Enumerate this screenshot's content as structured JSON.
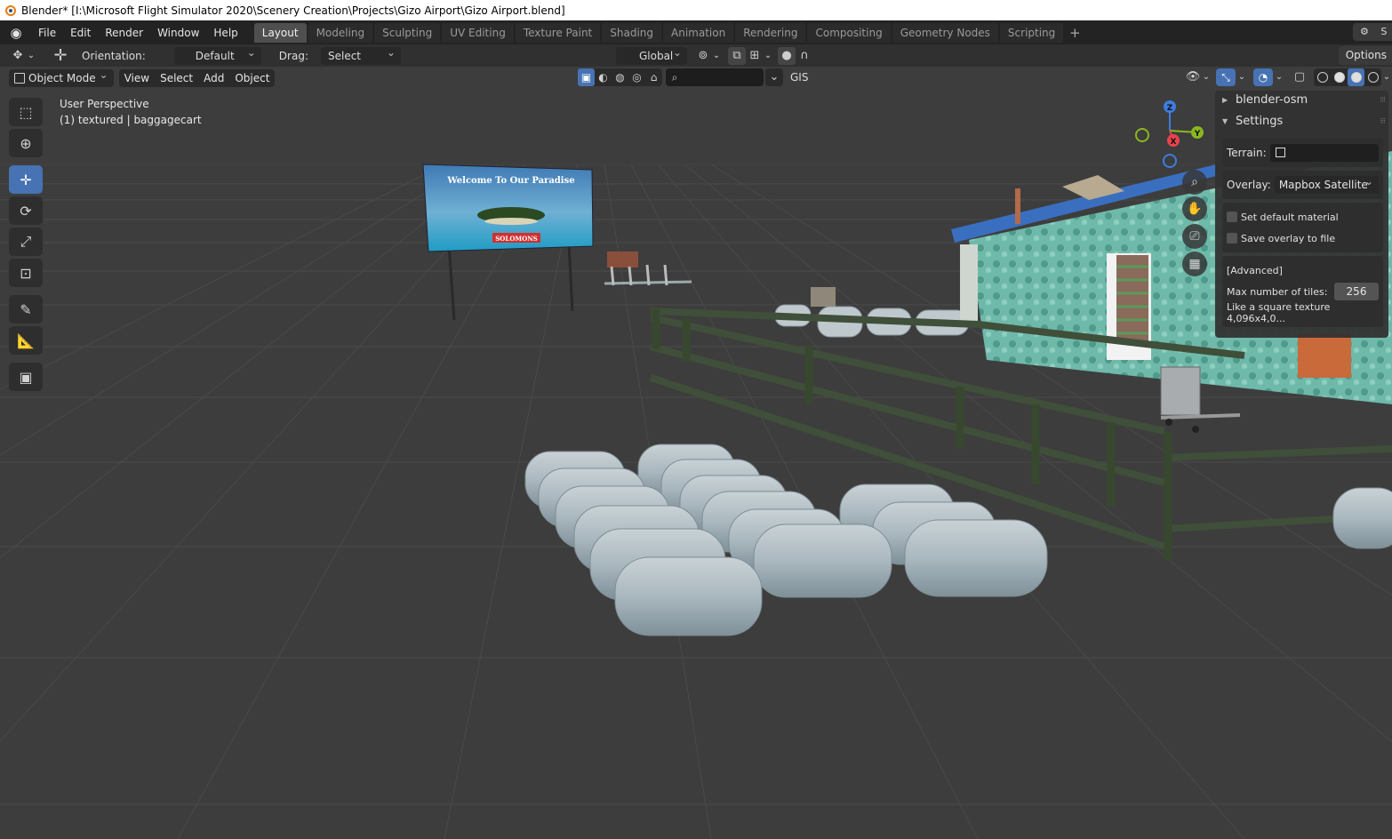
{
  "window": {
    "title": "Blender* [I:\\Microsoft Flight Simulator 2020\\Scenery Creation\\Projects\\Gizo Airport\\Gizo Airport.blend]"
  },
  "menu": {
    "items": [
      "File",
      "Edit",
      "Render",
      "Window",
      "Help"
    ]
  },
  "workspaces": {
    "tabs": [
      "Layout",
      "Modeling",
      "Sculpting",
      "UV Editing",
      "Texture Paint",
      "Shading",
      "Animation",
      "Rendering",
      "Compositing",
      "Geometry Nodes",
      "Scripting"
    ],
    "active": "Layout",
    "add_symbol": "+"
  },
  "scene_selector": {
    "label": "S"
  },
  "tool_header": {
    "orientation_label": "Orientation:",
    "orientation_value": "Default",
    "drag_label": "Drag:",
    "drag_value": "Select Box",
    "transform_orientation": "Global",
    "options_label": "Options"
  },
  "viewport_header": {
    "mode": "Object Mode",
    "menus": [
      "View",
      "Select",
      "Add",
      "Object"
    ],
    "gis_label": "GIS",
    "search_value": ""
  },
  "viewport": {
    "perspective_label": "User Perspective",
    "object_info": "(1) textured | baggagecart",
    "billboard_title": "Welcome To Our Paradise",
    "billboard_sign": "SOLOMONS",
    "gizmo_axes": {
      "z": "Z",
      "y": "Y",
      "x": "X"
    }
  },
  "toolbar": {
    "tools": [
      "select-box",
      "cursor",
      "move",
      "rotate",
      "scale",
      "transform",
      "annotate",
      "measure",
      "add-cube"
    ],
    "active": "move"
  },
  "sidebar_panel": {
    "section1_title": "blender-osm",
    "section2_title": "Settings",
    "terrain_label": "Terrain:",
    "overlay_label": "Overlay:",
    "overlay_value": "Mapbox Satellite",
    "set_default_material_label": "Set default material",
    "set_default_material_checked": false,
    "save_overlay_label": "Save overlay to file",
    "save_overlay_checked": false,
    "advanced_label": "[Advanced]",
    "max_tiles_label": "Max number of tiles:",
    "max_tiles_value": "256",
    "note": "Like a square texture 4,096x4,0..."
  },
  "colors": {
    "accent": "#4772b3",
    "axis_x": "#e8434d",
    "axis_y": "#8ab71f",
    "axis_z": "#3d7de0",
    "viewport_bg": "#3d3d3d"
  }
}
